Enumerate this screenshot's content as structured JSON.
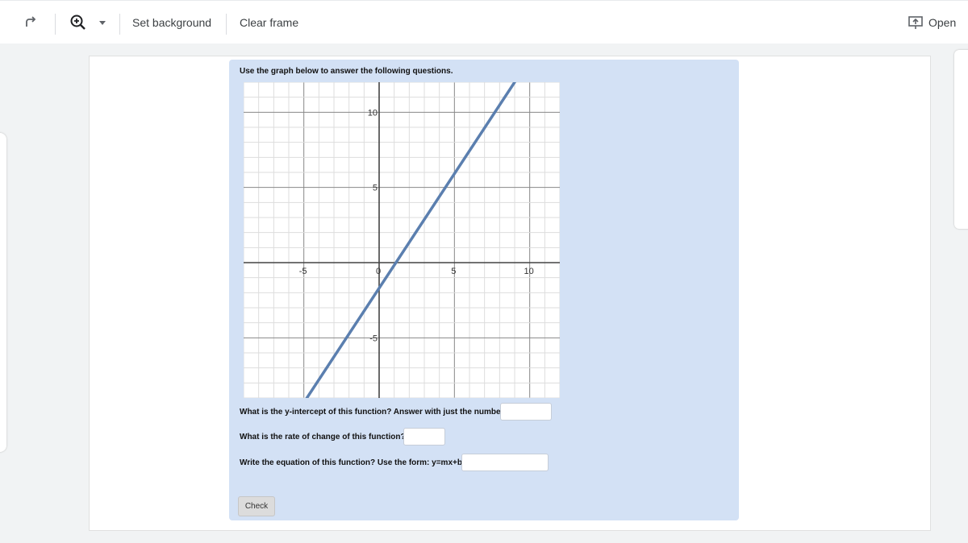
{
  "toolbar": {
    "set_background_label": "Set background",
    "clear_frame_label": "Clear frame",
    "open_label": "Open",
    "icons": [
      "redo-icon",
      "zoom-in-icon",
      "dropdown-arrow-icon",
      "present-icon"
    ]
  },
  "activity": {
    "instruction": "Use the graph below to answer the following questions.",
    "questions": [
      {
        "text": "What is the y-intercept of this function? Answer with just the number.",
        "value": ""
      },
      {
        "text": "What is the rate of change of this function?",
        "value": ""
      },
      {
        "text": "Write the equation of this function? Use the form: y=mx+b.",
        "value": ""
      }
    ],
    "check_label": "Check"
  },
  "chart_data": {
    "type": "line",
    "xlim": [
      -9,
      12
    ],
    "ylim": [
      -9,
      12
    ],
    "grid": true,
    "x_ticks": [
      -5,
      0,
      5,
      10
    ],
    "y_ticks": [
      -5,
      5,
      10
    ],
    "x_tick_labels": [
      "-5",
      "0",
      "5",
      "10"
    ],
    "y_tick_labels": [
      "-5",
      "5",
      "10"
    ],
    "series": [
      {
        "x": [
          -4.8,
          9.0
        ],
        "y": [
          -9.0,
          12.0
        ],
        "color": "#5b7faf"
      }
    ]
  }
}
